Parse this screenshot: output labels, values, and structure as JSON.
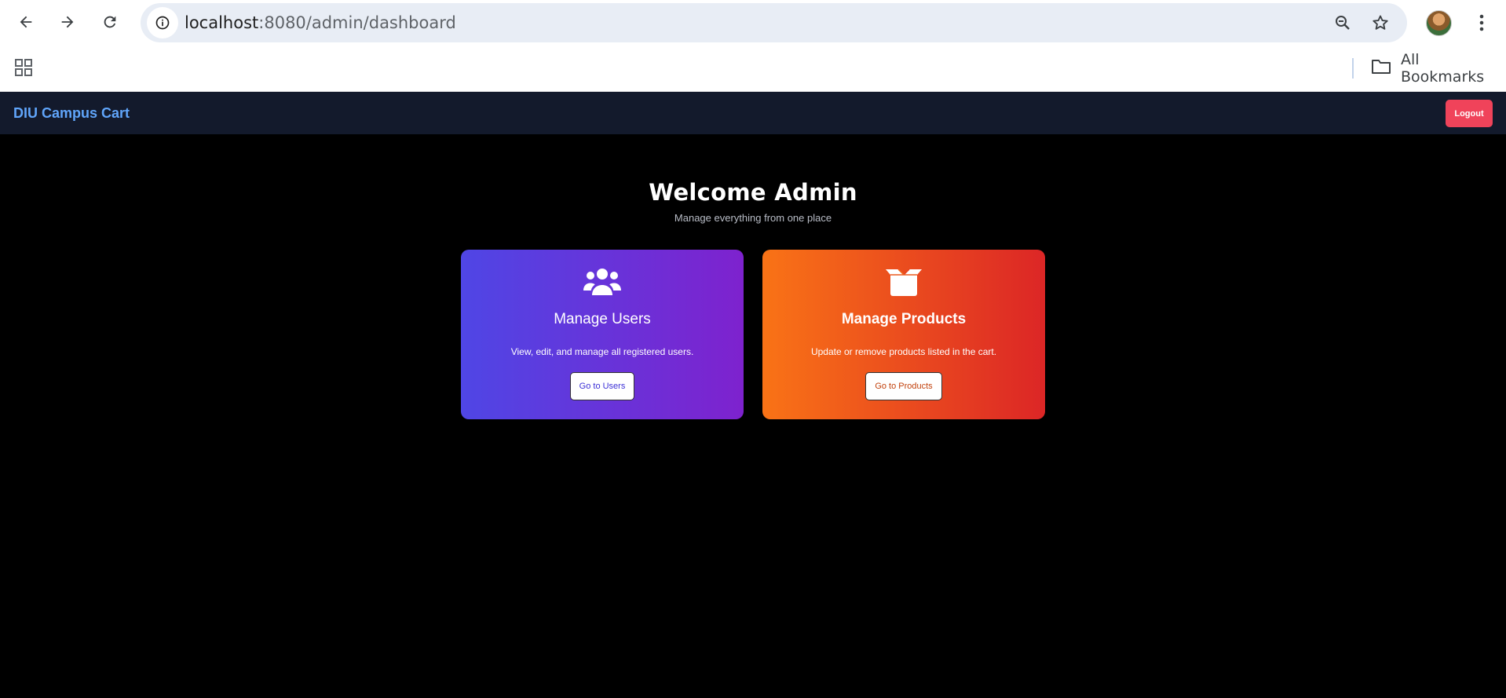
{
  "browser": {
    "url_host": "localhost",
    "url_path": ":8080/admin/dashboard",
    "bookmarks_label": "All Bookmarks",
    "icons": {
      "back": "back-arrow-icon",
      "forward": "forward-arrow-icon",
      "reload": "reload-icon",
      "site_info": "info-icon",
      "zoom": "zoom-out-icon",
      "bookmark": "star-icon",
      "menu": "kebab-menu-icon",
      "apps": "apps-grid-icon",
      "folder": "folder-icon"
    }
  },
  "app": {
    "brand": "DIU Campus Cart",
    "logout_label": "Logout",
    "colors": {
      "header_bg": "#131a2c",
      "brand": "#60a5fa",
      "logout_bg": "#f0435a",
      "page_bg": "#000000"
    }
  },
  "dashboard": {
    "title": "Welcome Admin",
    "subtitle": "Manage everything from one place",
    "cards": [
      {
        "icon": "users-icon",
        "title": "Manage Users",
        "description": "View, edit, and manage all registered users.",
        "button_label": "Go to Users",
        "gradient": [
          "#4f46e5",
          "#7e22ce"
        ]
      },
      {
        "icon": "box-icon",
        "title": "Manage Products",
        "description": "Update or remove products listed in the cart.",
        "button_label": "Go to Products",
        "gradient": [
          "#f97316",
          "#dc2626"
        ]
      }
    ]
  }
}
